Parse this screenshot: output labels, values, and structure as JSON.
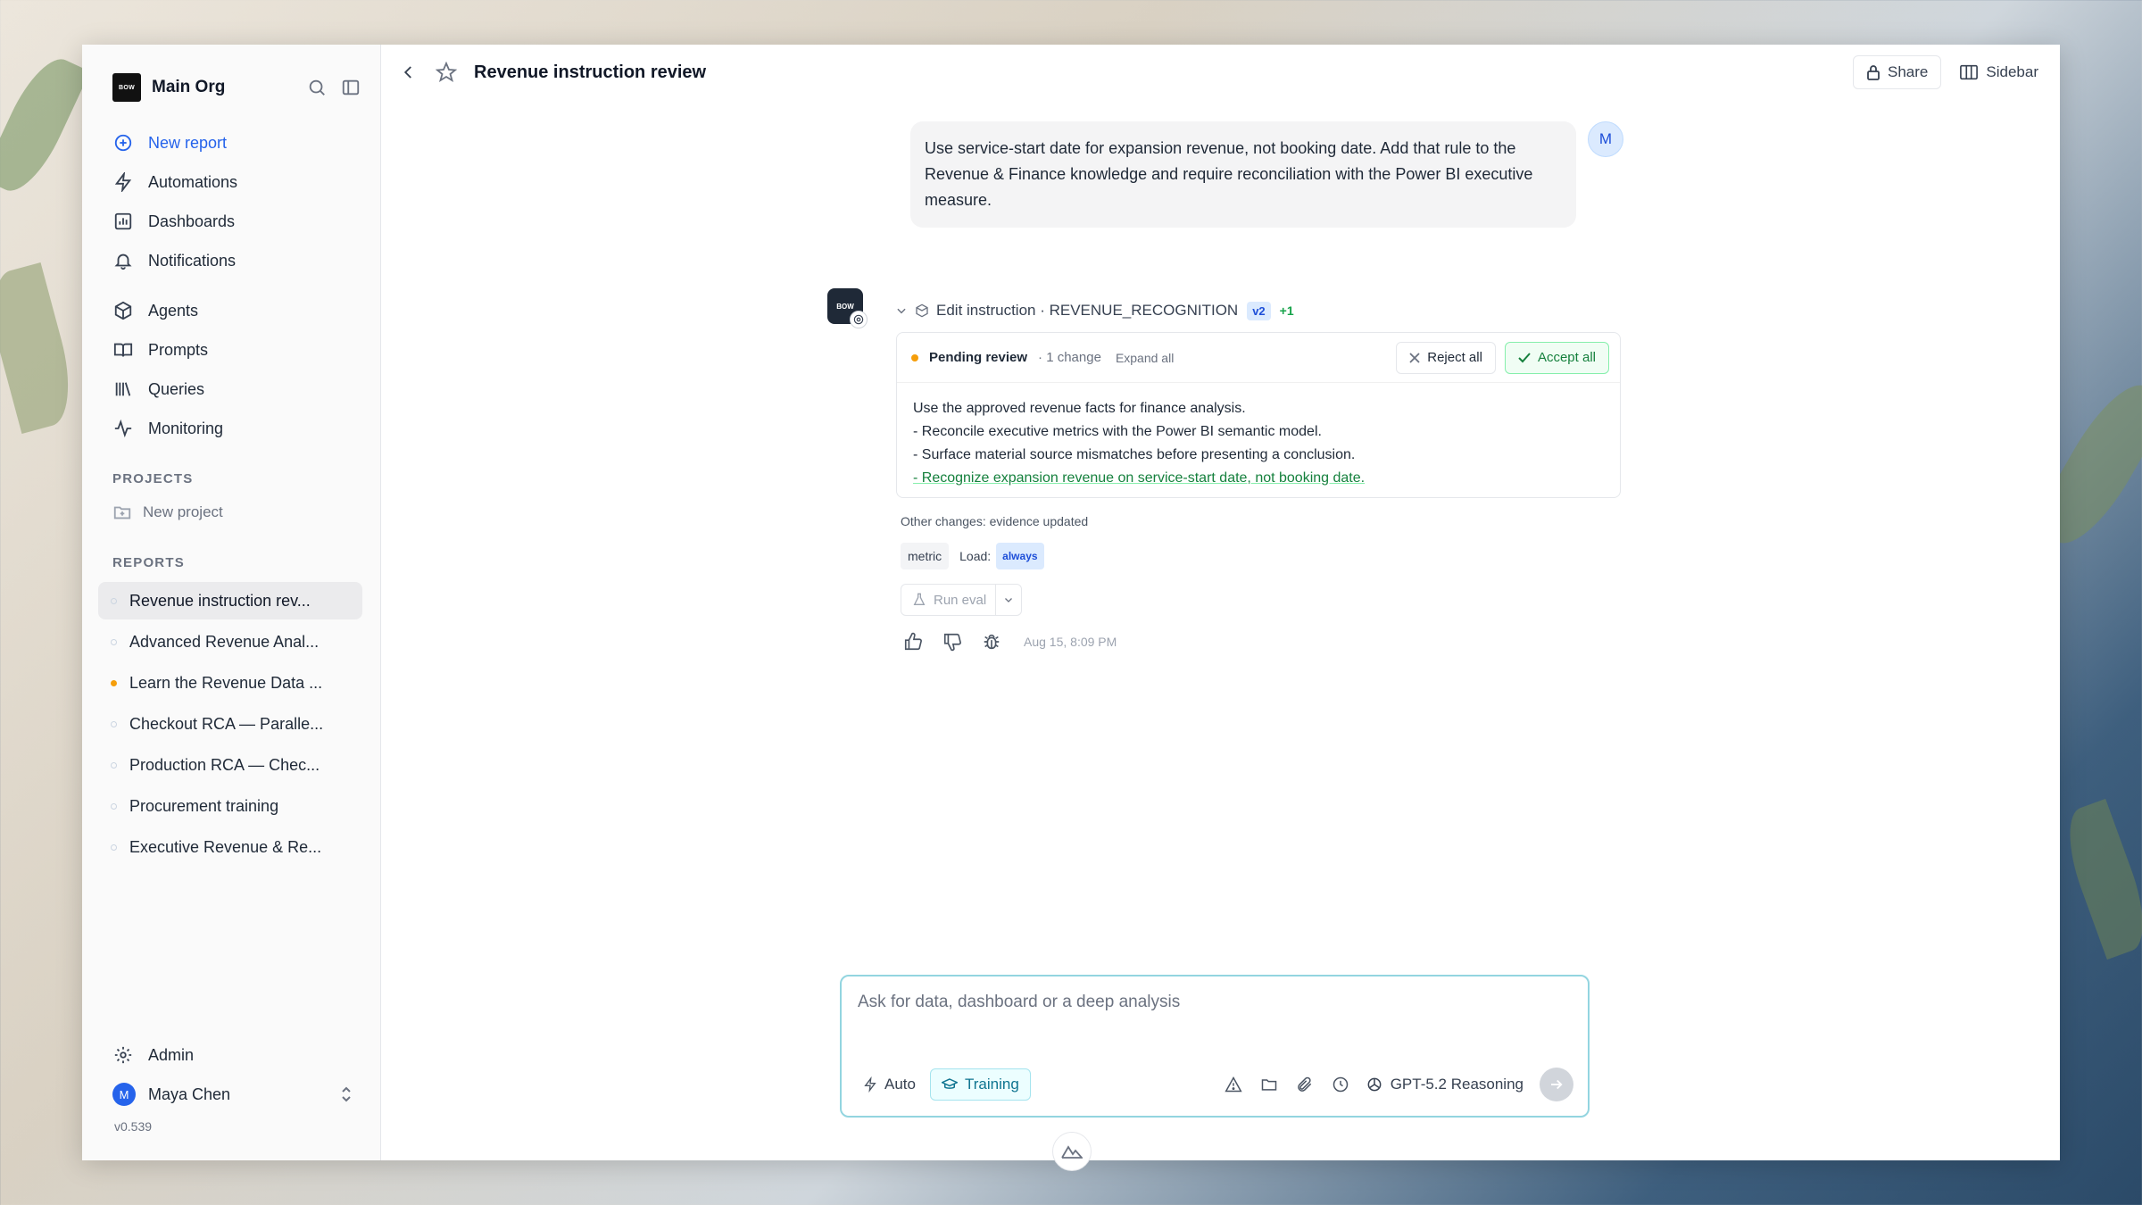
{
  "app": {
    "org_name": "Main Org",
    "org_logo_text": "BOW",
    "version": "v0.539"
  },
  "sidebar": {
    "nav": [
      {
        "label": "New report",
        "icon": "plus-circle-icon"
      },
      {
        "label": "Automations",
        "icon": "bolt-icon"
      },
      {
        "label": "Dashboards",
        "icon": "chart-icon"
      },
      {
        "label": "Notifications",
        "icon": "bell-icon"
      },
      {
        "label": "Agents",
        "icon": "cube-icon"
      },
      {
        "label": "Prompts",
        "icon": "book-icon"
      },
      {
        "label": "Queries",
        "icon": "library-icon"
      },
      {
        "label": "Monitoring",
        "icon": "pulse-icon"
      }
    ],
    "projects_title": "PROJECTS",
    "new_project": "New project",
    "reports_title": "REPORTS",
    "reports": [
      {
        "label": "Revenue instruction rev...",
        "active": true
      },
      {
        "label": "Advanced Revenue Anal..."
      },
      {
        "label": "Learn the Revenue Data ...",
        "status": "orange"
      },
      {
        "label": "Checkout RCA — Paralle..."
      },
      {
        "label": "Production RCA — Chec..."
      },
      {
        "label": "Procurement training"
      },
      {
        "label": "Executive Revenue & Re..."
      }
    ],
    "admin": "Admin",
    "user_name": "Maya Chen",
    "user_initial": "M"
  },
  "header": {
    "title": "Revenue instruction review",
    "share_label": "Share",
    "sidebar_label": "Sidebar"
  },
  "conversation": {
    "user_initial": "M",
    "user_message": "Use service-start date for expansion revenue, not booking date. Add that rule to the Revenue & Finance knowledge and require reconciliation with the Power BI executive measure.",
    "bot_logo_text": "BOW",
    "edit_label": "Edit instruction · REVENUE_RECOGNITION",
    "version_pill": "v2",
    "extra_count": "+1",
    "review": {
      "status": "Pending review",
      "change_count": "· 1 change",
      "expand_all": "Expand all",
      "reject_label": "Reject all",
      "accept_label": "Accept all",
      "lines": [
        "Use the approved revenue facts for finance analysis.",
        "- Reconcile executive metrics with the Power BI semantic model.",
        "- Surface material source mismatches before presenting a conclusion."
      ],
      "added_line": "- Recognize expansion revenue on service-start date, not booking date."
    },
    "other_changes": "Other changes: evidence updated",
    "tag_metric": "metric",
    "load_label": "Load:",
    "tag_always": "always",
    "run_eval": "Run eval",
    "timestamp": "Aug 15, 8:09 PM"
  },
  "composer": {
    "placeholder": "Ask for data, dashboard or a deep analysis",
    "auto_label": "Auto",
    "training_label": "Training",
    "model_label": "GPT-5.2 Reasoning"
  }
}
